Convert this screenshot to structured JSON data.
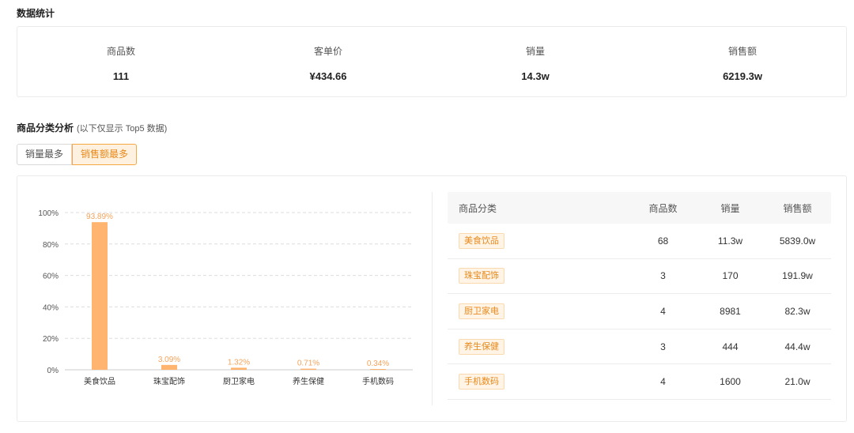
{
  "stats": {
    "title": "数据统计",
    "items": [
      {
        "label": "商品数",
        "value": "111"
      },
      {
        "label": "客单价",
        "value": "¥434.66"
      },
      {
        "label": "销量",
        "value": "14.3w"
      },
      {
        "label": "销售额",
        "value": "6219.3w"
      }
    ]
  },
  "analysis": {
    "title": "商品分类分析",
    "subtitle": "(以下仅显示 Top5 数据)",
    "tabs": [
      {
        "label": "销量最多",
        "active": false
      },
      {
        "label": "销售额最多",
        "active": true
      }
    ]
  },
  "chart_data": {
    "type": "bar",
    "categories": [
      "美食饮品",
      "珠宝配饰",
      "厨卫家电",
      "养生保健",
      "手机数码"
    ],
    "values": [
      93.89,
      3.09,
      1.32,
      0.71,
      0.34
    ],
    "data_labels": [
      "93.89%",
      "3.09%",
      "1.32%",
      "0.71%",
      "0.34%"
    ],
    "yticks": [
      "0%",
      "20%",
      "40%",
      "60%",
      "80%",
      "100%"
    ],
    "ylim": [
      0,
      100
    ],
    "grid": true,
    "bar_color": "#ffb570",
    "label_color": "#f5a35a"
  },
  "table": {
    "headers": [
      "商品分类",
      "商品数",
      "销量",
      "销售额"
    ],
    "rows": [
      {
        "category": "美食饮品",
        "count": "68",
        "sales": "11.3w",
        "amount": "5839.0w"
      },
      {
        "category": "珠宝配饰",
        "count": "3",
        "sales": "170",
        "amount": "191.9w"
      },
      {
        "category": "厨卫家电",
        "count": "4",
        "sales": "8981",
        "amount": "82.3w"
      },
      {
        "category": "养生保健",
        "count": "3",
        "sales": "444",
        "amount": "44.4w"
      },
      {
        "category": "手机数码",
        "count": "4",
        "sales": "1600",
        "amount": "21.0w"
      }
    ]
  }
}
